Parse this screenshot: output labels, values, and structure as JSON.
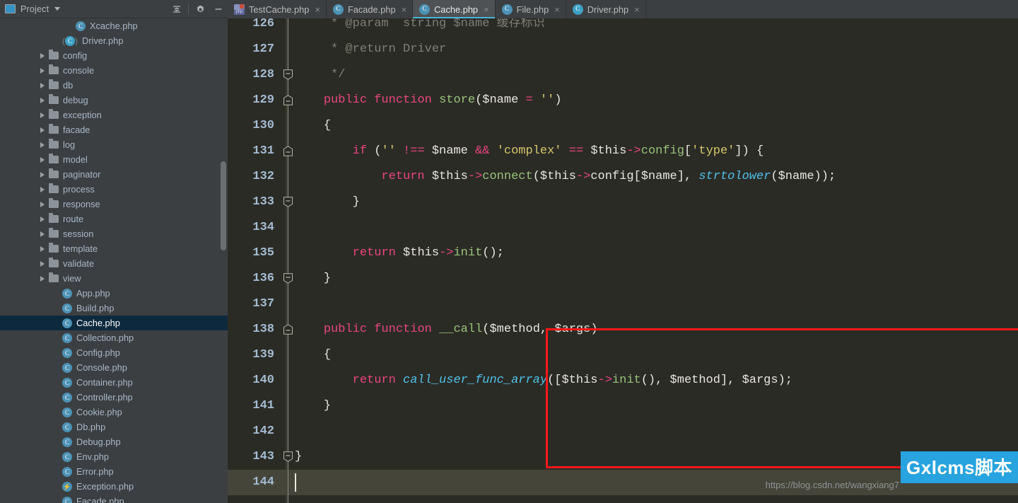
{
  "sidebar": {
    "header": {
      "title": "Project",
      "icons": [
        "project-icon",
        "chevron-down-icon",
        "collapse-all-icon",
        "settings-gear-icon",
        "hide-icon"
      ]
    },
    "tree": [
      {
        "label": "Xcache.php",
        "type": "class",
        "indent": 5,
        "arrow": false,
        "selected": false
      },
      {
        "label": "Driver.php",
        "type": "interface",
        "indent": 4,
        "arrow": false,
        "selected": false
      },
      {
        "label": "config",
        "type": "folder",
        "indent": 3,
        "arrow": true,
        "selected": false
      },
      {
        "label": "console",
        "type": "folder",
        "indent": 3,
        "arrow": true,
        "selected": false
      },
      {
        "label": "db",
        "type": "folder",
        "indent": 3,
        "arrow": true,
        "selected": false
      },
      {
        "label": "debug",
        "type": "folder",
        "indent": 3,
        "arrow": true,
        "selected": false
      },
      {
        "label": "exception",
        "type": "folder",
        "indent": 3,
        "arrow": true,
        "selected": false
      },
      {
        "label": "facade",
        "type": "folder",
        "indent": 3,
        "arrow": true,
        "selected": false
      },
      {
        "label": "log",
        "type": "folder",
        "indent": 3,
        "arrow": true,
        "selected": false
      },
      {
        "label": "model",
        "type": "folder",
        "indent": 3,
        "arrow": true,
        "selected": false
      },
      {
        "label": "paginator",
        "type": "folder",
        "indent": 3,
        "arrow": true,
        "selected": false
      },
      {
        "label": "process",
        "type": "folder",
        "indent": 3,
        "arrow": true,
        "selected": false
      },
      {
        "label": "response",
        "type": "folder",
        "indent": 3,
        "arrow": true,
        "selected": false
      },
      {
        "label": "route",
        "type": "folder",
        "indent": 3,
        "arrow": true,
        "selected": false
      },
      {
        "label": "session",
        "type": "folder",
        "indent": 3,
        "arrow": true,
        "selected": false
      },
      {
        "label": "template",
        "type": "folder",
        "indent": 3,
        "arrow": true,
        "selected": false
      },
      {
        "label": "validate",
        "type": "folder",
        "indent": 3,
        "arrow": true,
        "selected": false
      },
      {
        "label": "view",
        "type": "folder",
        "indent": 3,
        "arrow": true,
        "selected": false
      },
      {
        "label": "App.php",
        "type": "class",
        "indent": 4,
        "arrow": false,
        "selected": false
      },
      {
        "label": "Build.php",
        "type": "class",
        "indent": 4,
        "arrow": false,
        "selected": false
      },
      {
        "label": "Cache.php",
        "type": "class",
        "indent": 4,
        "arrow": false,
        "selected": true
      },
      {
        "label": "Collection.php",
        "type": "class",
        "indent": 4,
        "arrow": false,
        "selected": false
      },
      {
        "label": "Config.php",
        "type": "class",
        "indent": 4,
        "arrow": false,
        "selected": false
      },
      {
        "label": "Console.php",
        "type": "class",
        "indent": 4,
        "arrow": false,
        "selected": false
      },
      {
        "label": "Container.php",
        "type": "class",
        "indent": 4,
        "arrow": false,
        "selected": false
      },
      {
        "label": "Controller.php",
        "type": "class",
        "indent": 4,
        "arrow": false,
        "selected": false
      },
      {
        "label": "Cookie.php",
        "type": "class",
        "indent": 4,
        "arrow": false,
        "selected": false
      },
      {
        "label": "Db.php",
        "type": "class",
        "indent": 4,
        "arrow": false,
        "selected": false
      },
      {
        "label": "Debug.php",
        "type": "class",
        "indent": 4,
        "arrow": false,
        "selected": false
      },
      {
        "label": "Env.php",
        "type": "class",
        "indent": 4,
        "arrow": false,
        "selected": false
      },
      {
        "label": "Error.php",
        "type": "class",
        "indent": 4,
        "arrow": false,
        "selected": false
      },
      {
        "label": "Exception.php",
        "type": "exception",
        "indent": 4,
        "arrow": false,
        "selected": false
      },
      {
        "label": "Facade.php",
        "type": "class",
        "indent": 4,
        "arrow": false,
        "selected": false
      }
    ]
  },
  "tabs": [
    {
      "label": "TestCache.php",
      "icon": "php-unit-test-icon",
      "active": false,
      "close": "×"
    },
    {
      "label": "Facade.php",
      "icon": "php-class-icon",
      "active": false,
      "close": "×"
    },
    {
      "label": "Cache.php",
      "icon": "php-class-icon",
      "active": true,
      "close": "×"
    },
    {
      "label": "File.php",
      "icon": "php-class-icon",
      "active": false,
      "close": "×"
    },
    {
      "label": "Driver.php",
      "icon": "php-interface-icon",
      "active": false,
      "close": "×"
    }
  ],
  "editor": {
    "first_line": 126,
    "current_line": 144,
    "lines": [
      {
        "n": 126,
        "fold": null,
        "tokens": [
          {
            "t": "     * @param  string $name 缓存标识",
            "c": "cmt"
          }
        ]
      },
      {
        "n": 127,
        "fold": null,
        "tokens": [
          {
            "t": "     * @return Driver",
            "c": "cmt"
          }
        ]
      },
      {
        "n": 128,
        "fold": "end",
        "tokens": [
          {
            "t": "     */",
            "c": "cmt"
          }
        ]
      },
      {
        "n": 129,
        "fold": "start",
        "tokens": [
          {
            "t": "    ",
            "c": "plain"
          },
          {
            "t": "public",
            "c": "kw"
          },
          {
            "t": " ",
            "c": "plain"
          },
          {
            "t": "function",
            "c": "kw"
          },
          {
            "t": " ",
            "c": "plain"
          },
          {
            "t": "store",
            "c": "fn"
          },
          {
            "t": "(",
            "c": "plain"
          },
          {
            "t": "$name",
            "c": "var"
          },
          {
            "t": " ",
            "c": "plain"
          },
          {
            "t": "=",
            "c": "kw"
          },
          {
            "t": " ",
            "c": "plain"
          },
          {
            "t": "''",
            "c": "str"
          },
          {
            "t": ")",
            "c": "plain"
          }
        ]
      },
      {
        "n": 130,
        "fold": null,
        "tokens": [
          {
            "t": "    {",
            "c": "plain"
          }
        ]
      },
      {
        "n": 131,
        "fold": "start",
        "tokens": [
          {
            "t": "        ",
            "c": "plain"
          },
          {
            "t": "if",
            "c": "kw"
          },
          {
            "t": " (",
            "c": "plain"
          },
          {
            "t": "''",
            "c": "str"
          },
          {
            "t": " ",
            "c": "plain"
          },
          {
            "t": "!==",
            "c": "kw"
          },
          {
            "t": " ",
            "c": "plain"
          },
          {
            "t": "$name",
            "c": "var"
          },
          {
            "t": " ",
            "c": "plain"
          },
          {
            "t": "&&",
            "c": "amp"
          },
          {
            "t": " ",
            "c": "plain"
          },
          {
            "t": "'complex'",
            "c": "str"
          },
          {
            "t": " ",
            "c": "plain"
          },
          {
            "t": "==",
            "c": "kw"
          },
          {
            "t": " ",
            "c": "plain"
          },
          {
            "t": "$this",
            "c": "var"
          },
          {
            "t": "->",
            "c": "arrow-op"
          },
          {
            "t": "config",
            "c": "fn"
          },
          {
            "t": "[",
            "c": "plain"
          },
          {
            "t": "'type'",
            "c": "str"
          },
          {
            "t": "]) {",
            "c": "plain"
          }
        ]
      },
      {
        "n": 132,
        "fold": null,
        "tokens": [
          {
            "t": "            ",
            "c": "plain"
          },
          {
            "t": "return",
            "c": "kw"
          },
          {
            "t": " ",
            "c": "plain"
          },
          {
            "t": "$this",
            "c": "var"
          },
          {
            "t": "->",
            "c": "arrow-op"
          },
          {
            "t": "connect",
            "c": "fn"
          },
          {
            "t": "(",
            "c": "plain"
          },
          {
            "t": "$this",
            "c": "var"
          },
          {
            "t": "->",
            "c": "arrow-op"
          },
          {
            "t": "config",
            "c": "plain"
          },
          {
            "t": "[",
            "c": "plain"
          },
          {
            "t": "$name",
            "c": "var"
          },
          {
            "t": "], ",
            "c": "plain"
          },
          {
            "t": "strtolower",
            "c": "fnit"
          },
          {
            "t": "(",
            "c": "plain"
          },
          {
            "t": "$name",
            "c": "var"
          },
          {
            "t": "));",
            "c": "plain"
          }
        ]
      },
      {
        "n": 133,
        "fold": "end",
        "tokens": [
          {
            "t": "        }",
            "c": "plain"
          }
        ]
      },
      {
        "n": 134,
        "fold": null,
        "tokens": [
          {
            "t": "",
            "c": "plain"
          }
        ]
      },
      {
        "n": 135,
        "fold": null,
        "tokens": [
          {
            "t": "        ",
            "c": "plain"
          },
          {
            "t": "return",
            "c": "kw"
          },
          {
            "t": " ",
            "c": "plain"
          },
          {
            "t": "$this",
            "c": "var"
          },
          {
            "t": "->",
            "c": "arrow-op"
          },
          {
            "t": "init",
            "c": "fn"
          },
          {
            "t": "();",
            "c": "plain"
          }
        ]
      },
      {
        "n": 136,
        "fold": "end",
        "tokens": [
          {
            "t": "    }",
            "c": "plain"
          }
        ]
      },
      {
        "n": 137,
        "fold": null,
        "tokens": [
          {
            "t": "",
            "c": "plain"
          }
        ]
      },
      {
        "n": 138,
        "fold": "start",
        "tokens": [
          {
            "t": "    ",
            "c": "plain"
          },
          {
            "t": "public",
            "c": "kw"
          },
          {
            "t": " ",
            "c": "plain"
          },
          {
            "t": "function",
            "c": "kw"
          },
          {
            "t": " ",
            "c": "plain"
          },
          {
            "t": "__call",
            "c": "fn"
          },
          {
            "t": "(",
            "c": "plain"
          },
          {
            "t": "$method",
            "c": "var"
          },
          {
            "t": ", ",
            "c": "plain"
          },
          {
            "t": "$args",
            "c": "var"
          },
          {
            "t": ")",
            "c": "plain"
          }
        ]
      },
      {
        "n": 139,
        "fold": null,
        "tokens": [
          {
            "t": "    {",
            "c": "plain"
          }
        ]
      },
      {
        "n": 140,
        "fold": null,
        "tokens": [
          {
            "t": "        ",
            "c": "plain"
          },
          {
            "t": "return",
            "c": "kw"
          },
          {
            "t": " ",
            "c": "plain"
          },
          {
            "t": "call_user_func_array",
            "c": "fnit"
          },
          {
            "t": "([",
            "c": "plain"
          },
          {
            "t": "$this",
            "c": "var"
          },
          {
            "t": "->",
            "c": "arrow-op"
          },
          {
            "t": "init",
            "c": "fn"
          },
          {
            "t": "(), ",
            "c": "plain"
          },
          {
            "t": "$method",
            "c": "var"
          },
          {
            "t": "], ",
            "c": "plain"
          },
          {
            "t": "$args",
            "c": "var"
          },
          {
            "t": ");",
            "c": "plain"
          }
        ]
      },
      {
        "n": 141,
        "fold": null,
        "tokens": [
          {
            "t": "    }",
            "c": "plain"
          }
        ]
      },
      {
        "n": 142,
        "fold": null,
        "tokens": [
          {
            "t": "",
            "c": "plain"
          }
        ]
      },
      {
        "n": 143,
        "fold": "end",
        "tokens": [
          {
            "t": "}",
            "c": "plain"
          }
        ]
      },
      {
        "n": 144,
        "fold": null,
        "tokens": [
          {
            "t": "",
            "c": "plain"
          }
        ]
      }
    ],
    "highlight_box": {
      "from_line": 138,
      "to_line": 142,
      "color": "#ff1717"
    }
  },
  "watermark": {
    "url": "https://blog.csdn.net/wangxiang7",
    "badge": "Gxlcms脚本"
  }
}
